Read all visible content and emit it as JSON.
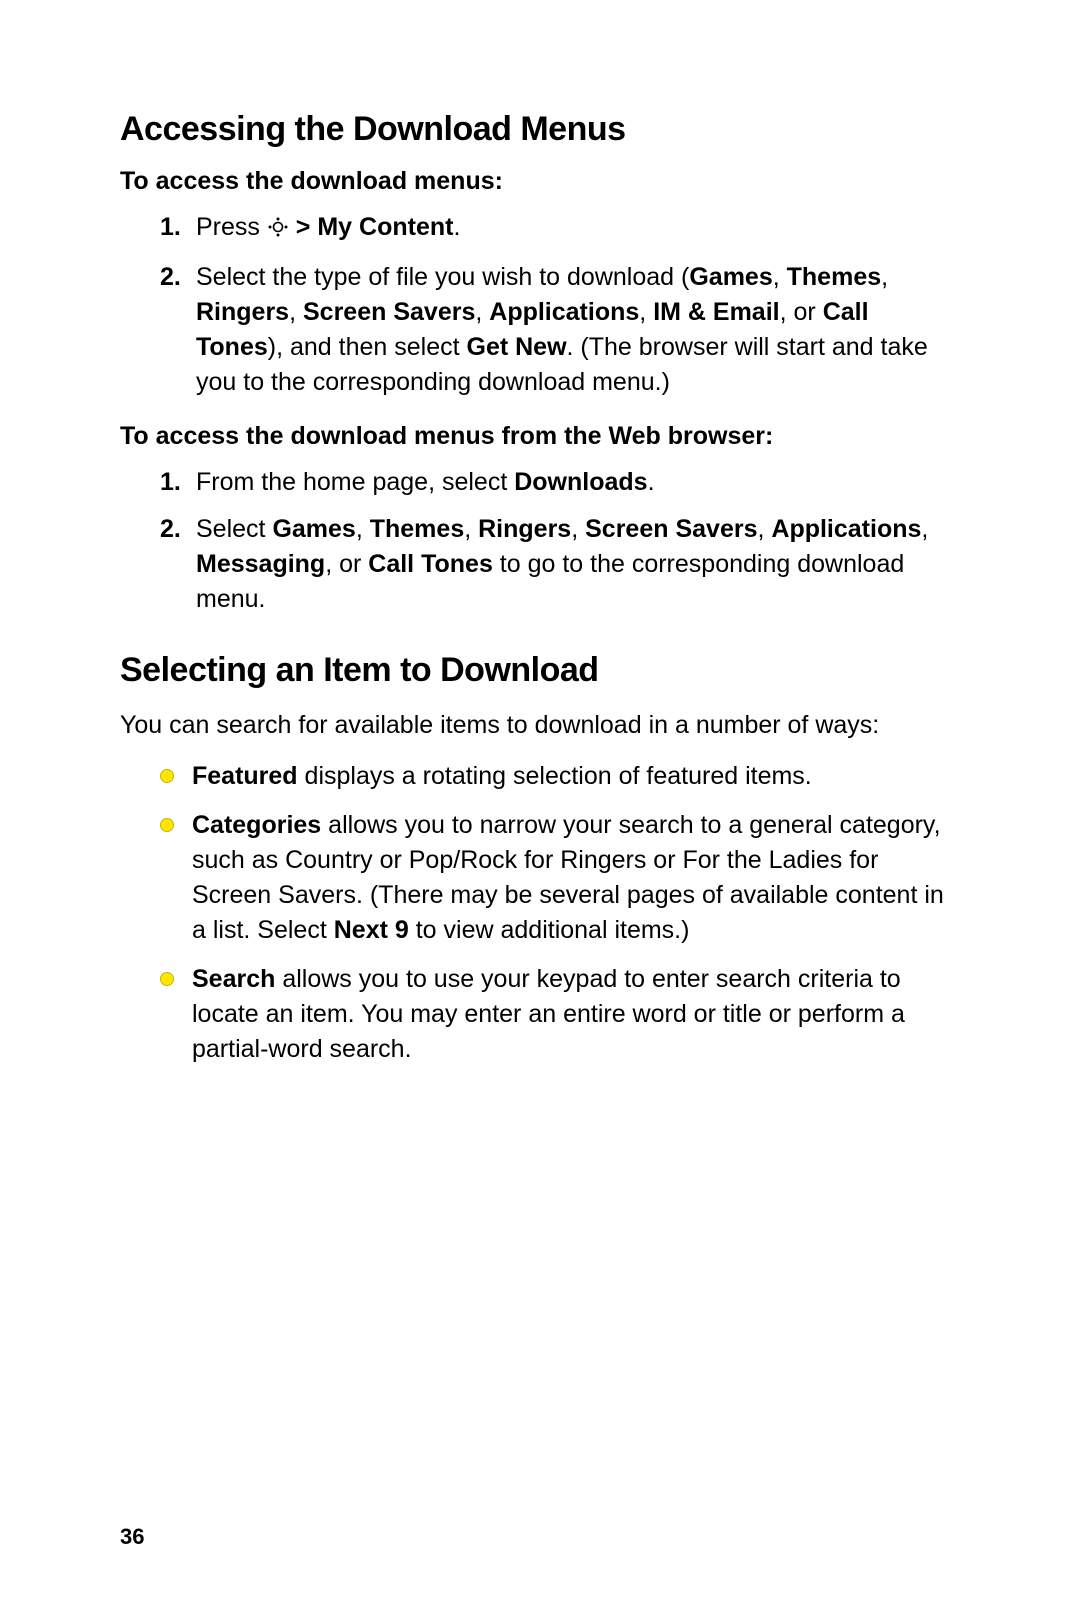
{
  "page_number": "36",
  "section1": {
    "heading": "Accessing the Download Menus",
    "sub1": "To access the download menus:",
    "step1": {
      "num": "1.",
      "pre": "Press ",
      "post_icon_bold": " > My Content",
      "period": "."
    },
    "step2": {
      "num": "2.",
      "t1": "Select the type of file you wish to download (",
      "b1": "Games",
      "c1": ", ",
      "b2": "Themes",
      "c2": ", ",
      "b3": "Ringers",
      "c3": ", ",
      "b4": "Screen Savers",
      "c4": ",  ",
      "b5": "Applications",
      "c5": ", ",
      "b6": "IM & Email",
      "c6": ", or ",
      "b7": "Call Tones",
      "t2": "), and then select ",
      "b8": "Get New",
      "t3": ". (The browser will start and take you to the corresponding download menu.)"
    },
    "sub2": "To access the download menus from the Web browser:",
    "b_step1": {
      "num": "1.",
      "t1": "From the home page, select ",
      "b1": "Downloads",
      "t2": "."
    },
    "b_step2": {
      "num": "2.",
      "t1": "Select ",
      "b1": "Games",
      "c1": ", ",
      "b2": "Themes",
      "c2": ", ",
      "b3": "Ringers",
      "c3": ", ",
      "b4": "Screen Savers",
      "c4": ", ",
      "b5": "Applications",
      "c5": ", ",
      "b6": "Messaging",
      "c6": ", or ",
      "b7": "Call Tones",
      "t2": " to go to the corresponding download menu."
    }
  },
  "section2": {
    "heading": "Selecting an Item to Download",
    "intro": "You can search for available items to download in a number of ways:",
    "bullet1": {
      "b": "Featured",
      "t": " displays a rotating selection of featured items."
    },
    "bullet2": {
      "b": "Categories",
      "t1": " allows you to narrow your search to a general category, such as Country or Pop/Rock for Ringers or For the Ladies for Screen Savers. (There may be several pages of available content in a list. Select ",
      "b2": "Next 9",
      "t2": " to view additional items.)"
    },
    "bullet3": {
      "b": "Search",
      "t": " allows you to use your keypad to enter search criteria to locate an item. You may enter an entire word or title or perform a partial-word search."
    }
  }
}
